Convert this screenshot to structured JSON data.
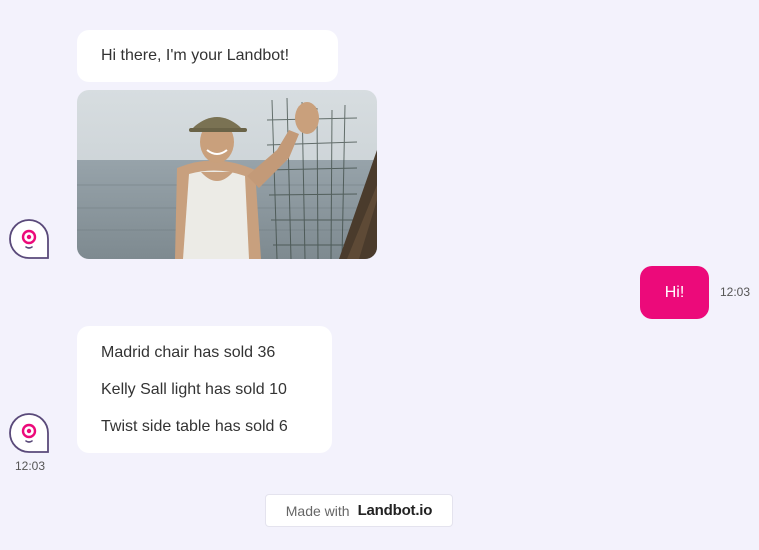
{
  "messages": {
    "greeting": "Hi there, I'm your Landbot!",
    "user_reply": "Hi!",
    "user_reply_time": "12:03",
    "sales": [
      "Madrid chair has sold 36",
      "Kelly Sall light has sold 10",
      "Twist side table has sold 6"
    ],
    "bot_time": "12:03"
  },
  "footer": {
    "made_with": "Made with",
    "brand": "Landbot.io"
  },
  "colors": {
    "background": "#f3f2fc",
    "user_bubble": "#ec0a7a",
    "avatar_accent": "#ec0a7a",
    "avatar_outline": "#5a4a7a"
  },
  "icons": {
    "bot_avatar": "landbot-avatar-icon"
  }
}
